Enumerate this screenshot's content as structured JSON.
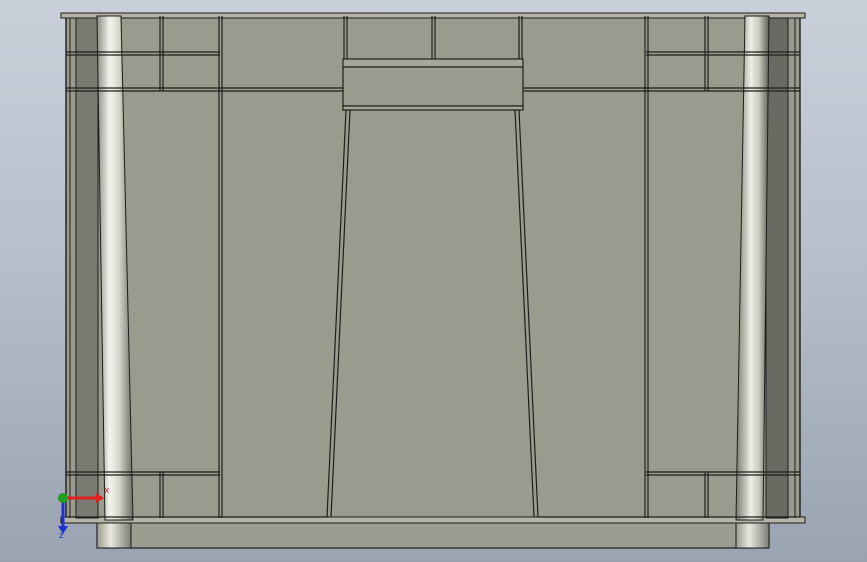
{
  "viewport": {
    "background_top": "#c9d0da",
    "background_bottom": "#9aa3b1",
    "model_face_color": "#9a9a8e",
    "edge_color": "#1e1e1c"
  },
  "triad": {
    "x_label": "x",
    "y_label": "",
    "z_label": "z",
    "x_color": "#e02020",
    "y_color": "#1fa01f",
    "z_color": "#2030d0"
  }
}
